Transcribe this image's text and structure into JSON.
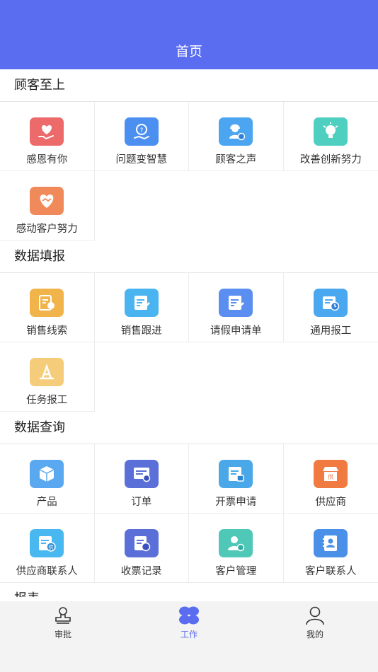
{
  "header": {
    "title": "首页"
  },
  "sections": [
    {
      "title": "顾客至上",
      "items": [
        {
          "label": "感恩有你",
          "icon": "heart-hand-icon",
          "color": "#ec6a6a"
        },
        {
          "label": "问题变智慧",
          "icon": "lightbulb-hand-icon",
          "color": "#4b8ff0"
        },
        {
          "label": "顾客之声",
          "icon": "customer-service-icon",
          "color": "#4ba5f0"
        },
        {
          "label": "改善创新努力",
          "icon": "innovation-bulb-icon",
          "color": "#4fcfc0"
        },
        {
          "label": "感动客户努力",
          "icon": "handshake-heart-icon",
          "color": "#f08a5a"
        }
      ]
    },
    {
      "title": "数据填报",
      "items": [
        {
          "label": "销售线索",
          "icon": "sales-lead-icon",
          "color": "#f0b44a"
        },
        {
          "label": "销售跟进",
          "icon": "sales-followup-icon",
          "color": "#4ab4f0"
        },
        {
          "label": "请假申请单",
          "icon": "leave-request-icon",
          "color": "#5a8ef0"
        },
        {
          "label": "通用报工",
          "icon": "work-report-icon",
          "color": "#4aa8f0"
        },
        {
          "label": "任务报工",
          "icon": "task-report-icon",
          "color": "#f5cd7a"
        }
      ]
    },
    {
      "title": "数据查询",
      "items": [
        {
          "label": "产品",
          "icon": "product-box-icon",
          "color": "#5aa8f0"
        },
        {
          "label": "订单",
          "icon": "order-icon",
          "color": "#5a6fd8"
        },
        {
          "label": "开票申请",
          "icon": "invoice-request-icon",
          "color": "#4aa8e8"
        },
        {
          "label": "供应商",
          "icon": "supplier-store-icon",
          "color": "#f07a40"
        },
        {
          "label": "供应商联系人",
          "icon": "supplier-contact-icon",
          "color": "#4ab8f0"
        },
        {
          "label": "收票记录",
          "icon": "receipt-record-icon",
          "color": "#5a70d8"
        },
        {
          "label": "客户管理",
          "icon": "customer-manage-icon",
          "color": "#4fc8b8"
        },
        {
          "label": "客户联系人",
          "icon": "customer-contact-icon",
          "color": "#4a90e8"
        }
      ]
    },
    {
      "title": "报表"
    }
  ],
  "tabbar": {
    "items": [
      {
        "label": "审批",
        "icon": "stamp-icon"
      },
      {
        "label": "工作",
        "icon": "clover-icon",
        "active": true
      },
      {
        "label": "我的",
        "icon": "person-icon"
      }
    ],
    "accent": "#5a6cf0"
  },
  "theme": {
    "header_bg": "#5a6cf0"
  }
}
